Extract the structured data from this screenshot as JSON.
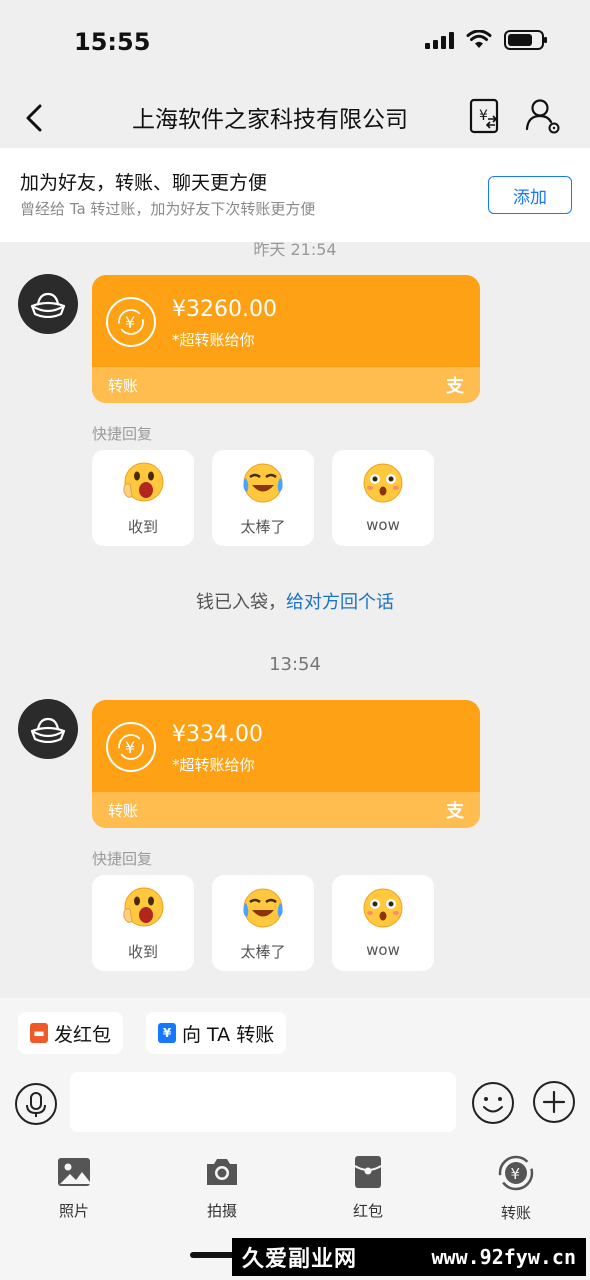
{
  "status": {
    "time": "15:55",
    "battery_level": 0.75
  },
  "nav": {
    "title": "上海软件之家科技有限公司",
    "back_icon": "chevron-left-icon",
    "transfer_icon": "transfer-record-icon",
    "profile_icon": "profile-settings-icon"
  },
  "friend_banner": {
    "title": "加为好友，转账、聊天更方便",
    "subtitle": "曾经给 Ta 转过账，加为好友下次转账更方便",
    "add_button": "添加"
  },
  "partial_timestamp": "昨天 21:54",
  "messages": [
    {
      "amount": "¥3260.00",
      "desc": "*超转账给你",
      "footer_label": "转账",
      "footer_logo": "支",
      "quick_reply_label": "快捷回复",
      "quick_replies": [
        {
          "label": "收到",
          "icon": "shocked-face-emoji"
        },
        {
          "label": "太棒了",
          "icon": "tears-of-joy-emoji"
        },
        {
          "label": "wow",
          "icon": "surprised-face-emoji"
        }
      ]
    },
    {
      "amount": "¥334.00",
      "desc": "*超转账给你",
      "footer_label": "转账",
      "footer_logo": "支",
      "quick_reply_label": "快捷回复",
      "quick_replies": [
        {
          "label": "收到",
          "icon": "shocked-face-emoji"
        },
        {
          "label": "太棒了",
          "icon": "tears-of-joy-emoji"
        },
        {
          "label": "wow",
          "icon": "surprised-face-emoji"
        }
      ]
    }
  ],
  "system_message": {
    "text": "钱已入袋，",
    "link": "给对方回个话"
  },
  "time_divider": "13:54",
  "actions": {
    "red_packet": "发红包",
    "transfer_to": "向 TA 转账"
  },
  "toolbar": [
    {
      "label": "照片",
      "icon": "photo-icon"
    },
    {
      "label": "拍摄",
      "icon": "camera-icon"
    },
    {
      "label": "红包",
      "icon": "red-packet-icon"
    },
    {
      "label": "转账",
      "icon": "transfer-icon"
    }
  ],
  "watermark": {
    "text": "久爱副业网",
    "url": "www.92fyw.cn"
  },
  "colors": {
    "card_orange": "#ffa114",
    "card_footer": "#ffbd50",
    "link_blue": "#1a73c9",
    "accent_blue": "#1677ff",
    "red_packet": "#f05a28"
  }
}
